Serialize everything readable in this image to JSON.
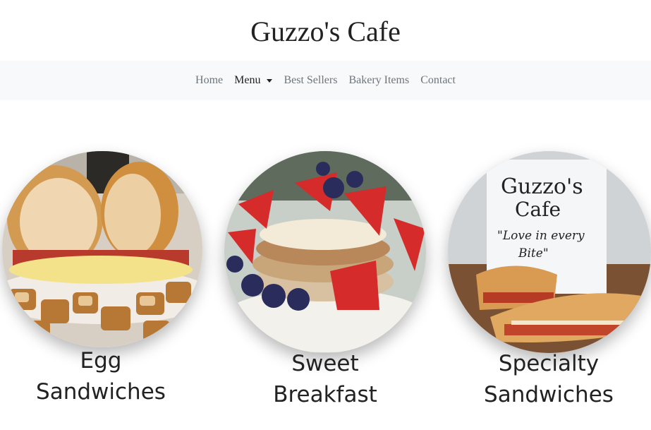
{
  "header": {
    "title": "Guzzo's Cafe"
  },
  "nav": {
    "items": [
      {
        "label": "Home"
      },
      {
        "label": "Menu"
      },
      {
        "label": "Best Sellers"
      },
      {
        "label": "Bakery Items"
      },
      {
        "label": "Contact"
      }
    ]
  },
  "cards": [
    {
      "line1": "Egg",
      "line2": "Sandwiches"
    },
    {
      "line1": "Sweet",
      "line2": "Breakfast"
    },
    {
      "line1": "Specialty",
      "line2": "Sandwiches"
    }
  ],
  "sign": {
    "line1": "Guzzo's",
    "line2": "Cafe",
    "line3": "\"Love in every",
    "line4": "Bite\""
  }
}
